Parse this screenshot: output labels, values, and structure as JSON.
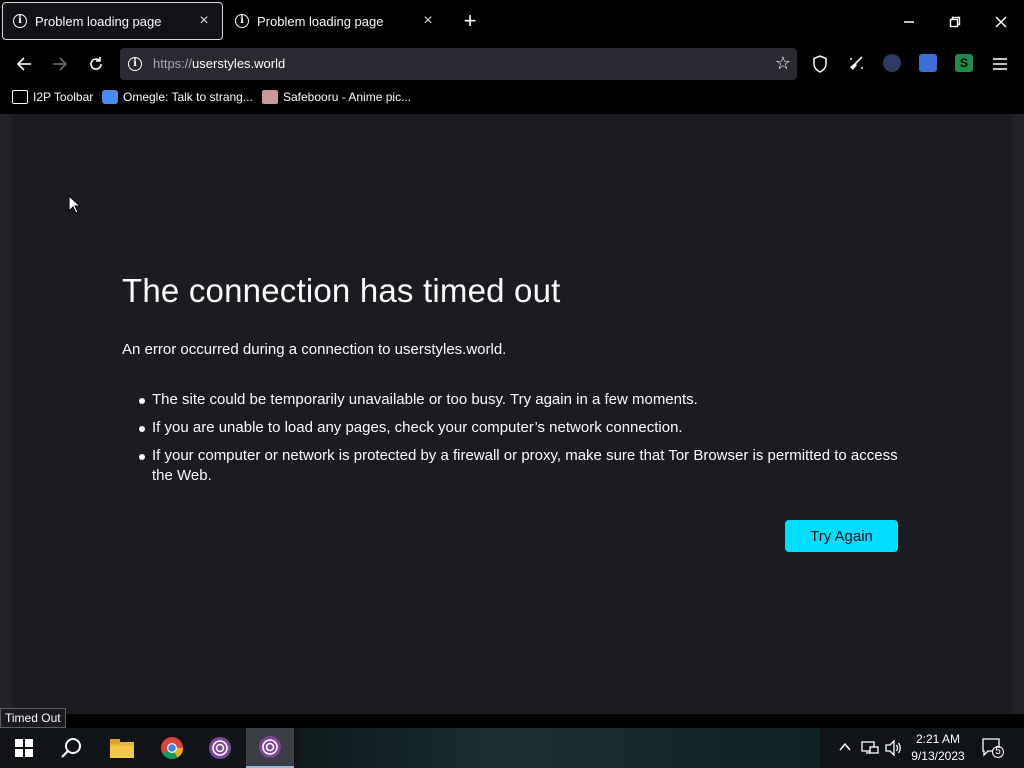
{
  "browser": {
    "tabs": [
      {
        "title": "Problem loading page",
        "active": true
      },
      {
        "title": "Problem loading page",
        "active": false
      }
    ],
    "url": {
      "scheme": "https://",
      "host": "userstyles.world"
    },
    "bookmarks": [
      {
        "label": "I2P Toolbar",
        "icon": "folder-icon"
      },
      {
        "label": "Omegle: Talk to strang...",
        "icon": "omegle-icon"
      },
      {
        "label": "Safebooru - Anime pic...",
        "icon": "safebooru-icon"
      }
    ]
  },
  "error_page": {
    "title": "The connection has timed out",
    "description": "An error occurred during a connection to userstyles.world.",
    "bullets": [
      "The site could be temporarily unavailable or too busy. Try again in a few moments.",
      "If you are unable to load any pages, check your computer’s network connection.",
      "If your computer or network is protected by a firewall or proxy, make sure that Tor Browser is permitted to access the Web."
    ],
    "try_again_label": "Try Again"
  },
  "status": {
    "text": "Timed Out"
  },
  "taskbar": {
    "time": "2:21 AM",
    "date": "9/13/2023",
    "notification_count": "5"
  },
  "colors": {
    "accent_button": "#00ddff",
    "page_background": "#1c1b22",
    "urlbar_background": "#2b2a33"
  }
}
